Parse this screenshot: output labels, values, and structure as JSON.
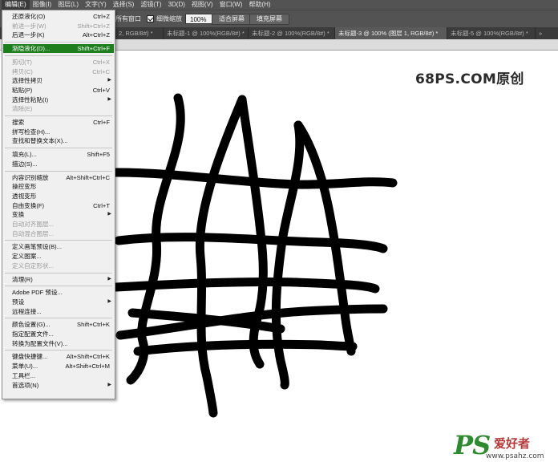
{
  "menubar": {
    "items": [
      "编辑(E)",
      "图像(I)",
      "图层(L)",
      "文字(Y)",
      "选择(S)",
      "滤镜(T)",
      "3D(D)",
      "视图(V)",
      "窗口(W)",
      "帮助(H)"
    ]
  },
  "options": {
    "all_windows_label": "所有窗口",
    "scrubby_zoom_label": "细微缩放",
    "zoom_value": "100%",
    "fit_screen": "适合屏幕",
    "fill_screen": "填充屏幕"
  },
  "tabs": [
    "2, RGB/8#) *",
    "未标题-1 @ 100%(RGB/8#) *",
    "未标题-2 @ 100%(RGB/8#) *",
    "未标题-3 @ 100% (图层 1, RGB/8#) *",
    "未标题-5 @ 100%(RGB/8#) *"
  ],
  "edit_menu": {
    "items": [
      {
        "label": "还原液化(O)",
        "shortcut": "Ctrl+Z"
      },
      {
        "label": "前进一步(W)",
        "shortcut": "Shift+Ctrl+Z",
        "disabled": true
      },
      {
        "label": "后退一步(K)",
        "shortcut": "Alt+Ctrl+Z"
      },
      {
        "sep": true
      },
      {
        "label": "渐隐液化(D)...",
        "shortcut": "Shift+Ctrl+F",
        "highlight": true
      },
      {
        "sep": true
      },
      {
        "label": "剪切(T)",
        "shortcut": "Ctrl+X",
        "disabled": true
      },
      {
        "label": "拷贝(C)",
        "shortcut": "Ctrl+C",
        "disabled": true
      },
      {
        "label": "选择性拷贝",
        "submenu": true
      },
      {
        "label": "粘贴(P)",
        "shortcut": "Ctrl+V"
      },
      {
        "label": "选择性粘贴(I)",
        "submenu": true
      },
      {
        "label": "清除(E)",
        "disabled": true
      },
      {
        "sep": true
      },
      {
        "label": "搜索",
        "shortcut": "Ctrl+F"
      },
      {
        "label": "拼写检查(H)..."
      },
      {
        "label": "查找和替换文本(X)..."
      },
      {
        "sep": true
      },
      {
        "label": "填充(L)...",
        "shortcut": "Shift+F5"
      },
      {
        "label": "描边(S)..."
      },
      {
        "sep": true
      },
      {
        "label": "内容识别缩放",
        "shortcut": "Alt+Shift+Ctrl+C"
      },
      {
        "label": "操控变形"
      },
      {
        "label": "透视变形"
      },
      {
        "label": "自由变换(F)",
        "shortcut": "Ctrl+T"
      },
      {
        "label": "变换",
        "submenu": true
      },
      {
        "label": "自动对齐图层...",
        "disabled": true
      },
      {
        "label": "自动混合图层...",
        "disabled": true
      },
      {
        "sep": true
      },
      {
        "label": "定义画笔预设(B)..."
      },
      {
        "label": "定义图案..."
      },
      {
        "label": "定义自定形状...",
        "disabled": true
      },
      {
        "sep": true
      },
      {
        "label": "清理(R)",
        "submenu": true
      },
      {
        "sep": true
      },
      {
        "label": "Adobe PDF 预设..."
      },
      {
        "label": "预设",
        "submenu": true
      },
      {
        "label": "远程连接..."
      },
      {
        "sep": true
      },
      {
        "label": "颜色设置(G)...",
        "shortcut": "Shift+Ctrl+K"
      },
      {
        "label": "指定配置文件..."
      },
      {
        "label": "转换为配置文件(V)..."
      },
      {
        "sep": true
      },
      {
        "label": "键盘快捷键...",
        "shortcut": "Alt+Shift+Ctrl+K"
      },
      {
        "label": "菜单(U)...",
        "shortcut": "Alt+Shift+Ctrl+M"
      },
      {
        "label": "工具栏..."
      },
      {
        "label": "首选项(N)",
        "submenu": true
      }
    ]
  },
  "watermark": "68PS.COM原创",
  "logo": {
    "ps": "PS",
    "cn": "爱好者",
    "url": "www.psahz.com"
  },
  "icons": {
    "checkbox": "checkbox-checked-icon",
    "submenu": "triangle-right-icon"
  },
  "colors": {
    "menu_highlight": "#1e7e1e",
    "ui_dark": "#535353",
    "stroke": "#000000",
    "logo_green": "#2e8a2e",
    "logo_red": "#b23a3a"
  }
}
